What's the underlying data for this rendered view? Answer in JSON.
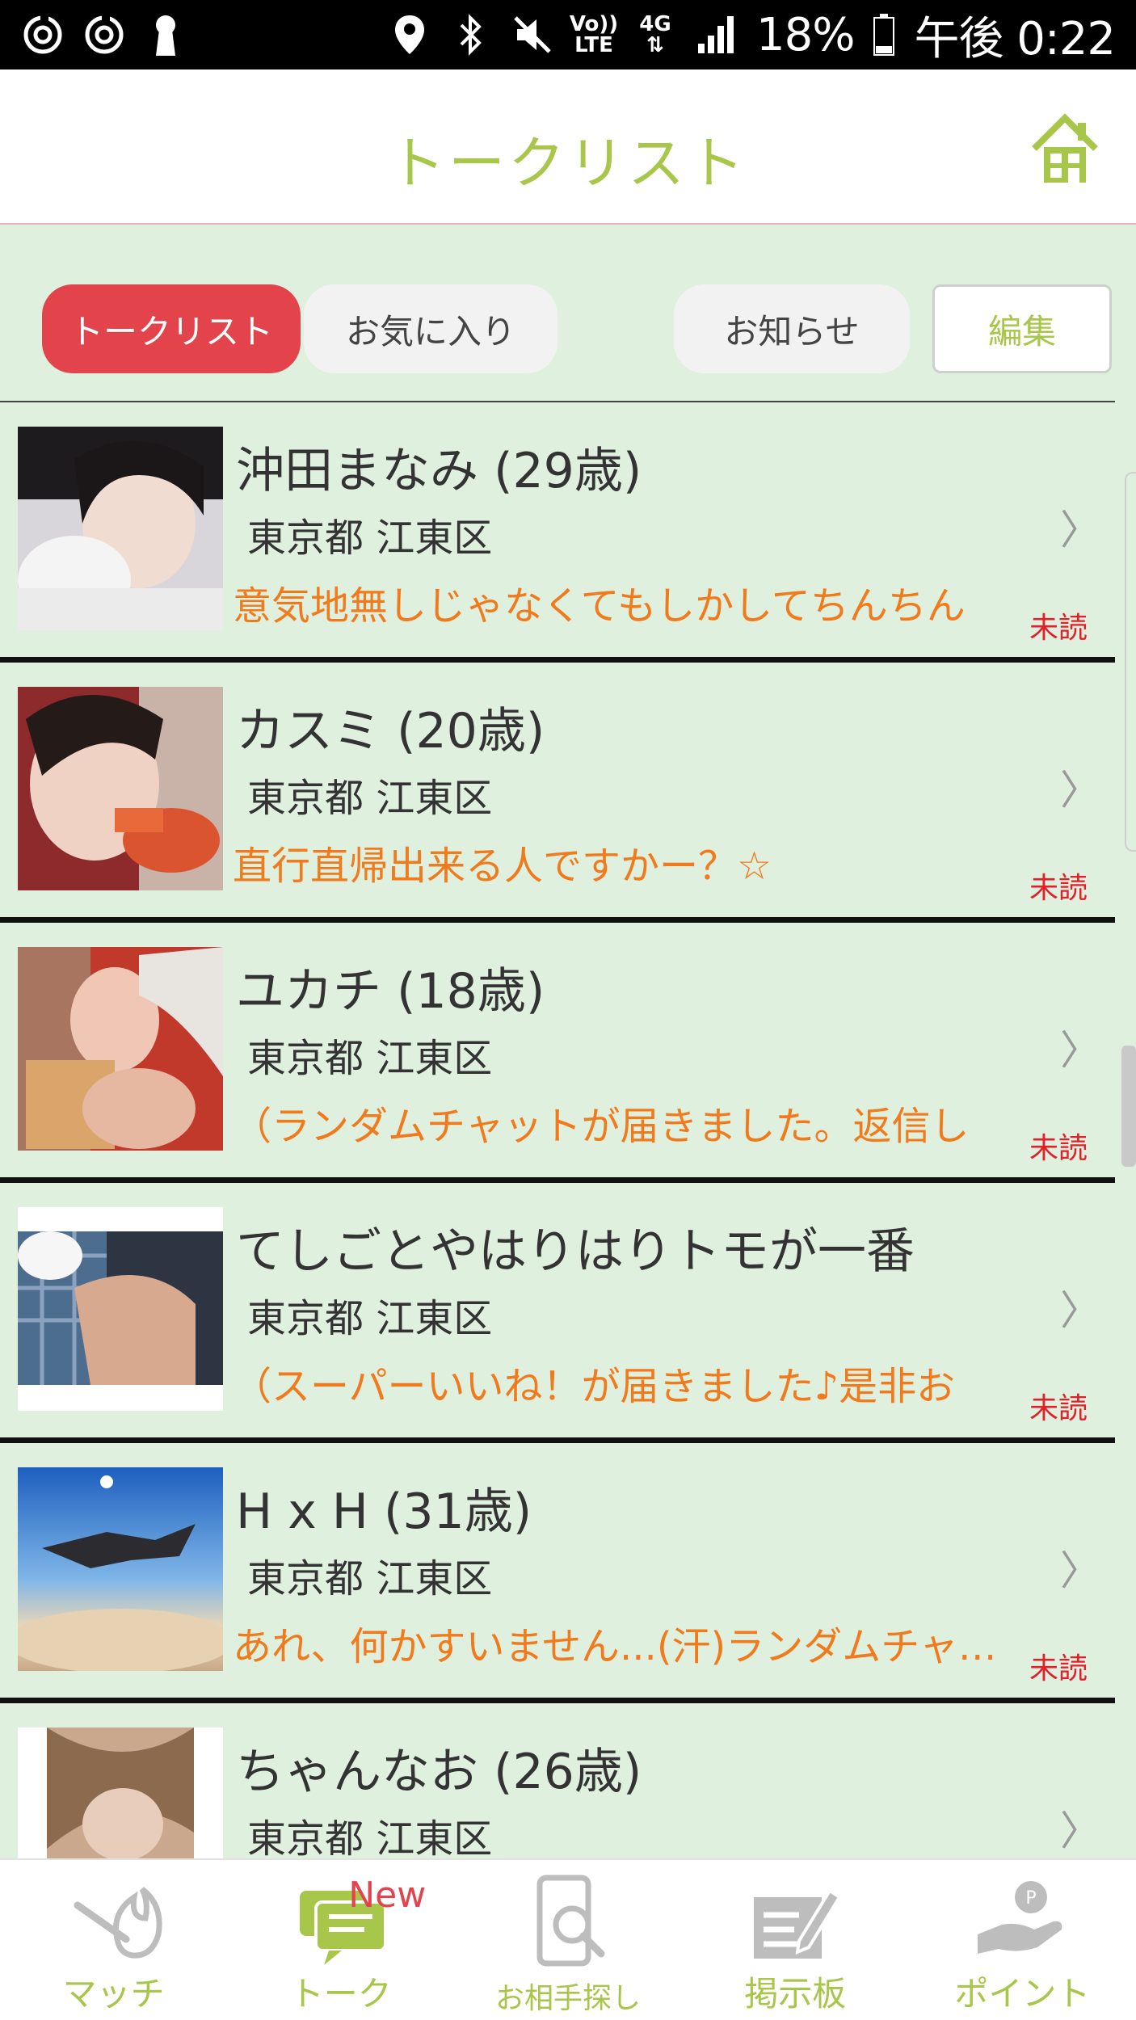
{
  "statusbar": {
    "battery": "18%",
    "time": "午後 0:22",
    "volte_top": "Vo))",
    "volte_bottom": "LTE",
    "network": "4G",
    "icons": [
      "sync-icon",
      "sync-icon",
      "keyhole-icon",
      "location-icon",
      "bluetooth-icon",
      "mute-icon",
      "volte-icon",
      "4g-icon",
      "signal-icon",
      "battery-icon"
    ]
  },
  "header": {
    "title": "トークリスト",
    "home_icon": "home-icon"
  },
  "tabs": {
    "talklist": "トークリスト",
    "favorite": "お気に入り",
    "notice": "お知らせ",
    "edit": "編集"
  },
  "list": {
    "items": [
      {
        "name": "沖田まなみ (29歳)",
        "area": "東京都 江東区",
        "message": "意気地無しじゃなくてもしかしてちんちん",
        "status": "未読"
      },
      {
        "name": "カスミ (20歳)",
        "area": "東京都 江東区",
        "message": "直行直帰出来る人ですかー？☆",
        "status": "未読"
      },
      {
        "name": "ユカチ (18歳)",
        "area": "東京都 江東区",
        "message": "（ランダムチャットが届きました。返信し",
        "status": "未読"
      },
      {
        "name": "てしごとやはりはりトモが一番",
        "area": "東京都 江東区",
        "message": "（スーパーいいね！が届きました♪是非お",
        "status": "未読"
      },
      {
        "name": "H x H (31歳)",
        "area": "東京都 江東区",
        "message": "あれ、何かすいません...(汗)ランダムチャ…",
        "status": "未読"
      },
      {
        "name": "ちゃんなお (26歳)",
        "area": "東京都 江東区",
        "message": "",
        "status": ""
      }
    ],
    "chevron": "〉"
  },
  "nav": {
    "match": "マッチ",
    "talk": "トーク",
    "talk_badge": "New",
    "search": "お相手探し",
    "board": "掲示板",
    "point": "ポイント"
  },
  "colors": {
    "accent": "#a8c64a",
    "active_tab": "#e3434a",
    "message": "#f07a1c",
    "unread": "#e3202a",
    "list_bg": "#e0f0df"
  }
}
